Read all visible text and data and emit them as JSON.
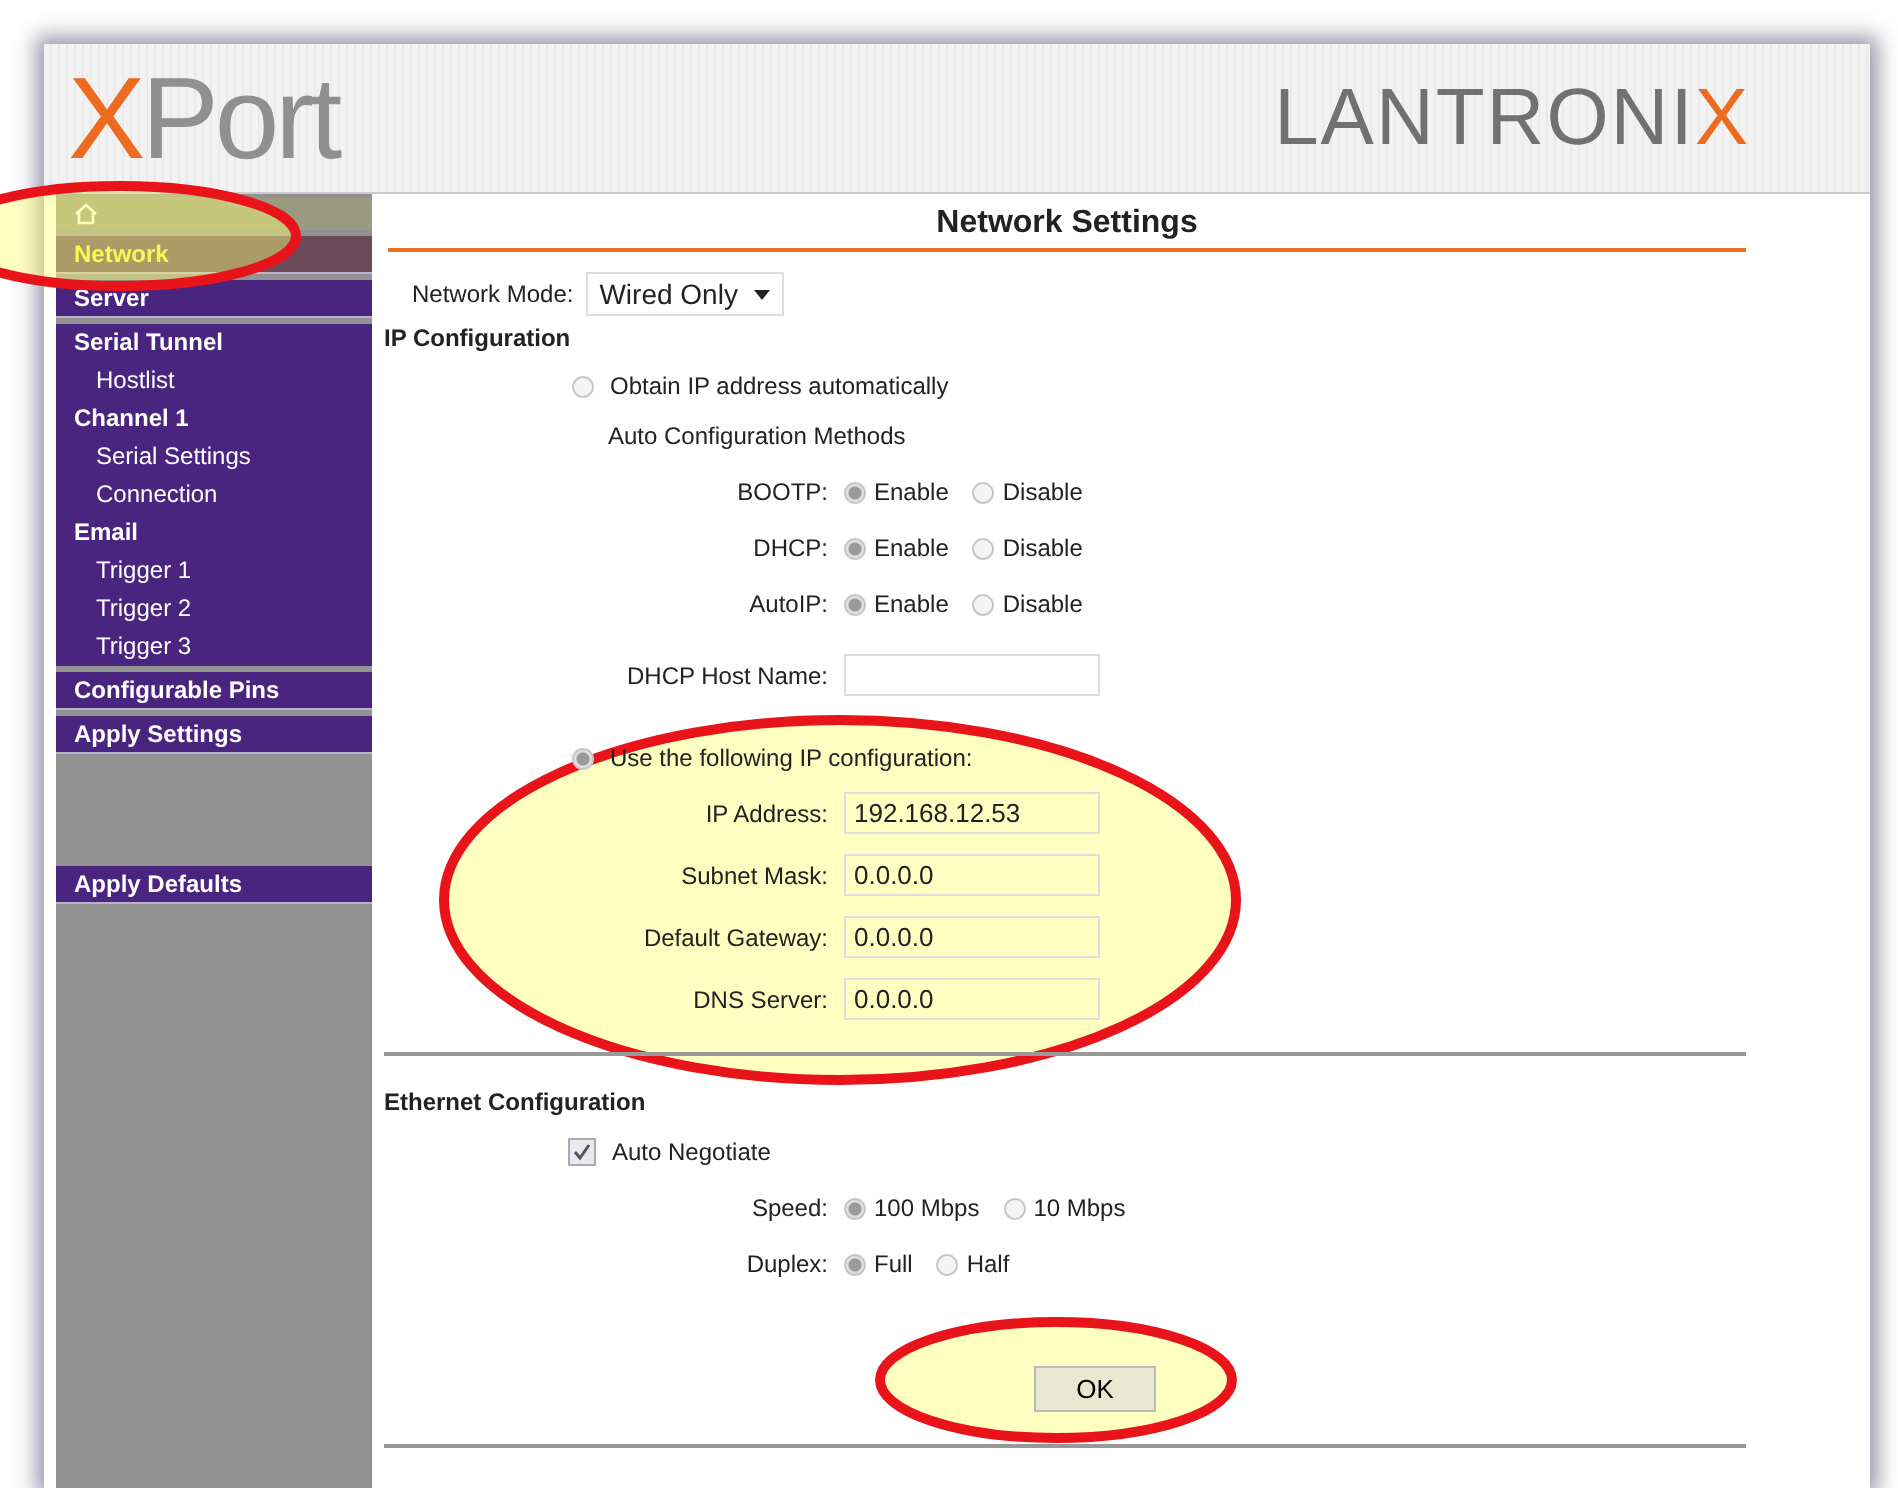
{
  "header": {
    "product_logo": {
      "accent": "X",
      "rest": "Port"
    },
    "brand_logo": {
      "rest": "LANTRONI",
      "accent": "X"
    }
  },
  "sidebar": {
    "items": [
      {
        "kind": "home",
        "selected": false
      },
      {
        "kind": "band",
        "label": "Network",
        "selected": true
      },
      {
        "kind": "band",
        "label": "Server",
        "selected": false
      },
      {
        "kind": "heading",
        "label": "Serial Tunnel",
        "selected": false
      },
      {
        "kind": "sub",
        "label": "Hostlist",
        "selected": false
      },
      {
        "kind": "heading",
        "label": "Channel 1",
        "selected": false
      },
      {
        "kind": "sub",
        "label": "Serial Settings",
        "selected": false
      },
      {
        "kind": "sub",
        "label": "Connection",
        "selected": false
      },
      {
        "kind": "heading",
        "label": "Email",
        "selected": false
      },
      {
        "kind": "sub",
        "label": "Trigger 1",
        "selected": false
      },
      {
        "kind": "sub",
        "label": "Trigger 2",
        "selected": false
      },
      {
        "kind": "sub",
        "label": "Trigger 3",
        "selected": false
      },
      {
        "kind": "band",
        "label": "Configurable Pins",
        "selected": false
      },
      {
        "kind": "band",
        "label": "Apply Settings",
        "selected": false
      },
      {
        "kind": "footer",
        "label": "Apply Defaults",
        "selected": false
      }
    ]
  },
  "title": "Network Settings",
  "network_mode": {
    "label": "Network Mode:",
    "value": "Wired Only"
  },
  "ip_configuration": {
    "heading": "IP Configuration",
    "automatic": {
      "label": "Obtain IP address automatically",
      "selected": false
    },
    "methods_heading": "Auto Configuration Methods",
    "methods": [
      {
        "label": "BOOTP:",
        "options": [
          {
            "label": "Enable",
            "selected": true
          },
          {
            "label": "Disable",
            "selected": false
          }
        ]
      },
      {
        "label": "DHCP:",
        "options": [
          {
            "label": "Enable",
            "selected": true
          },
          {
            "label": "Disable",
            "selected": false
          }
        ]
      },
      {
        "label": "AutoIP:",
        "options": [
          {
            "label": "Enable",
            "selected": true
          },
          {
            "label": "Disable",
            "selected": false
          }
        ]
      }
    ],
    "host_name": {
      "label": "DHCP Host Name:"
    },
    "manual": {
      "label": "Use the following IP configuration:",
      "selected": true
    },
    "fields": [
      {
        "label": "IP Address:",
        "value": "192.168.12.53"
      },
      {
        "label": "Subnet Mask:",
        "value": "0.0.0.0"
      },
      {
        "label": "Default Gateway:",
        "value": "0.0.0.0"
      },
      {
        "label": "DNS Server:",
        "value": "0.0.0.0"
      }
    ]
  },
  "ethernet": {
    "heading": "Ethernet Configuration",
    "auto_negotiate": {
      "label": "Auto Negotiate",
      "checked": true
    },
    "settings": [
      {
        "label": "Speed:",
        "options": [
          {
            "label": "100 Mbps",
            "selected": true
          },
          {
            "label": "10 Mbps",
            "selected": false
          }
        ]
      },
      {
        "label": "Duplex:",
        "options": [
          {
            "label": "Full",
            "selected": true
          },
          {
            "label": "Half",
            "selected": false
          }
        ]
      }
    ]
  },
  "ok_button": "OK"
}
